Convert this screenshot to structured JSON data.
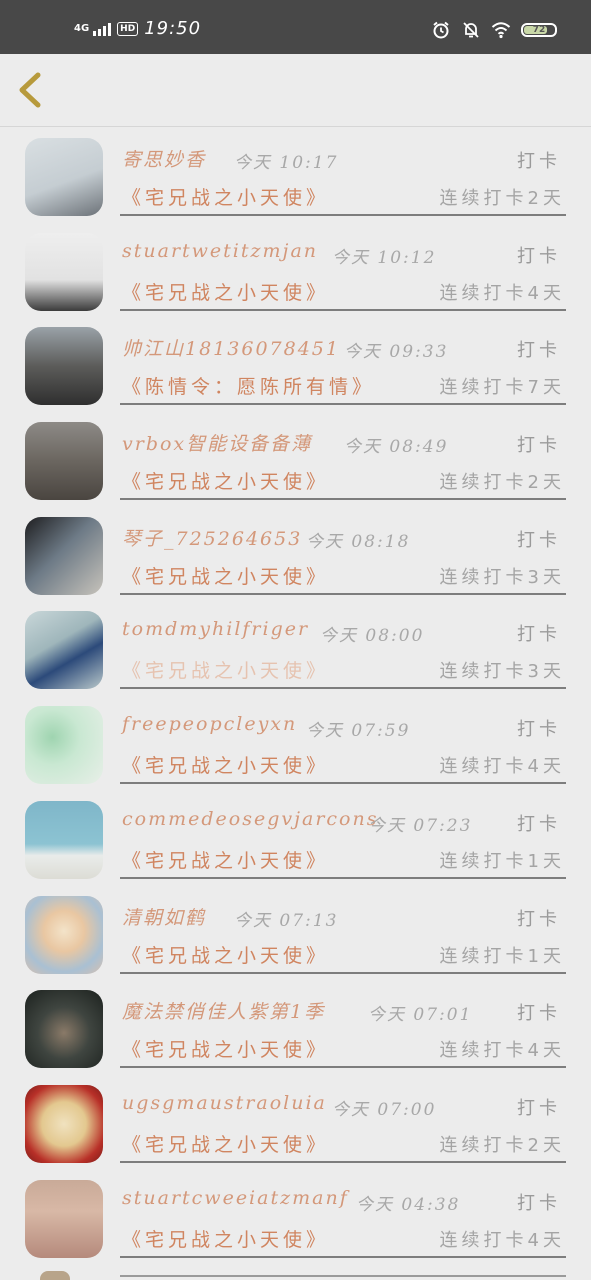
{
  "status_bar": {
    "network": "4G",
    "hd": "HD",
    "time": "19:50",
    "battery": "72",
    "battery_level": 0.72
  },
  "header": {
    "back_icon": "chevron-left-icon"
  },
  "rows": [
    {
      "name": "寄思妙香",
      "time": "今天 10:17",
      "action": "打卡",
      "book": "《宅兄战之小天使》",
      "streak": "连续打卡2天"
    },
    {
      "name": "stuartwetitzmjan",
      "time": "今天 10:12",
      "action": "打卡",
      "book": "《宅兄战之小天使》",
      "streak": "连续打卡4天"
    },
    {
      "name": "帅江山18136078451",
      "time": "今天 09:33",
      "action": "打卡",
      "book": "《陈情令：愿陈所有情》",
      "streak": "连续打卡7天"
    },
    {
      "name": "vrbox智能设备备薄",
      "time": "今天 08:49",
      "action": "打卡",
      "book": "《宅兄战之小天使》",
      "streak": "连续打卡2天"
    },
    {
      "name": "琴子_725264653",
      "time": "今天 08:18",
      "action": "打卡",
      "book": "《宅兄战之小天使》",
      "streak": "连续打卡3天"
    },
    {
      "name": "tomdmyhilfriger",
      "time": "今天 08:00",
      "action": "打卡",
      "book": "《宅兄战之小天使》",
      "streak": "连续打卡3天"
    },
    {
      "name": "freepeopcleyxn",
      "time": "今天 07:59",
      "action": "打卡",
      "book": "《宅兄战之小天使》",
      "streak": "连续打卡4天"
    },
    {
      "name": "commedeosegvjarcons",
      "time": "今天 07:23",
      "action": "打卡",
      "book": "《宅兄战之小天使》",
      "streak": "连续打卡1天"
    },
    {
      "name": "清朝如鹤",
      "time": "今天 07:13",
      "action": "打卡",
      "book": "《宅兄战之小天使》",
      "streak": "连续打卡1天"
    },
    {
      "name": "魔法禁俏佳人紫第1季",
      "time": "今天 07:01",
      "action": "打卡",
      "book": "《宅兄战之小天使》",
      "streak": "连续打卡4天"
    },
    {
      "name": "ugsgmaustraoluia",
      "time": "今天 07:00",
      "action": "打卡",
      "book": "《宅兄战之小天使》",
      "streak": "连续打卡2天"
    },
    {
      "name": "stuartcweeiatzmanf",
      "time": "今天 04:38",
      "action": "打卡",
      "book": "《宅兄战之小天使》",
      "streak": "连续打卡4天"
    }
  ]
}
